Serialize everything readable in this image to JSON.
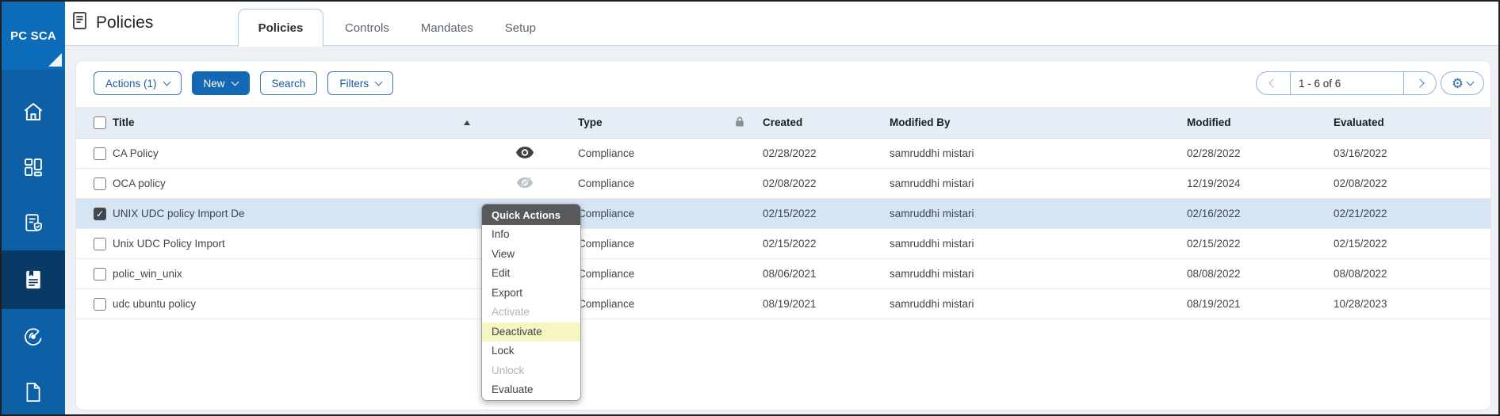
{
  "colors": {
    "accent": "#1468b3",
    "sidebar": "#0d60a6",
    "sidebar-badge": "#0c6cba",
    "sidebar-active": "#093a66",
    "row-highlight": "#d5e5f4",
    "menu-highlight": "#f6f6c3",
    "menu-header-bg": "#58595b",
    "table-header-bg": "#e7edf6"
  },
  "sidebar": {
    "badge": "PC SCA",
    "items": [
      {
        "icon": "home"
      },
      {
        "icon": "dashboard"
      },
      {
        "icon": "reports-shield"
      },
      {
        "icon": "policies-doc",
        "active": true
      },
      {
        "icon": "scans-gauge"
      },
      {
        "icon": "blank-doc"
      }
    ]
  },
  "header": {
    "title": "Policies",
    "tabs": [
      {
        "label": "Policies",
        "active": true
      },
      {
        "label": "Controls",
        "active": false
      },
      {
        "label": "Mandates",
        "active": false
      },
      {
        "label": "Setup",
        "active": false
      }
    ]
  },
  "toolbar": {
    "actions": "Actions (1)",
    "new": "New",
    "search": "Search",
    "filters": "Filters"
  },
  "pagination": {
    "range": "1 - 6 of 6"
  },
  "table": {
    "headers": {
      "title": "Title",
      "type": "Type",
      "created": "Created",
      "modified_by": "Modified By",
      "modified": "Modified",
      "evaluated": "Evaluated"
    },
    "rows": [
      {
        "title": "CA Policy",
        "visibility": "eye",
        "type": "Compliance",
        "created": "02/28/2022",
        "modified_by": "samruddhi mistari",
        "modified": "02/28/2022",
        "evaluated": "03/16/2022",
        "checked": false,
        "highlighted": false
      },
      {
        "title": "OCA policy",
        "visibility": "eye-off",
        "type": "Compliance",
        "created": "02/08/2022",
        "modified_by": "samruddhi mistari",
        "modified": "12/19/2024",
        "evaluated": "02/08/2022",
        "checked": false,
        "highlighted": false
      },
      {
        "title": "UNIX UDC policy Import De",
        "visibility": "eye",
        "type": "Compliance",
        "created": "02/15/2022",
        "modified_by": "samruddhi mistari",
        "modified": "02/16/2022",
        "evaluated": "02/21/2022",
        "checked": true,
        "highlighted": true
      },
      {
        "title": "Unix UDC Policy Import",
        "visibility": "eye",
        "type": "Compliance",
        "created": "02/15/2022",
        "modified_by": "samruddhi mistari",
        "modified": "02/15/2022",
        "evaluated": "02/15/2022",
        "checked": false,
        "highlighted": false
      },
      {
        "title": "polic_win_unix",
        "visibility": "eye",
        "type": "Compliance",
        "created": "08/06/2021",
        "modified_by": "samruddhi mistari",
        "modified": "08/08/2022",
        "evaluated": "08/08/2022",
        "checked": false,
        "highlighted": false
      },
      {
        "title": "udc ubuntu policy",
        "visibility": "eye",
        "type": "Compliance",
        "created": "08/19/2021",
        "modified_by": "samruddhi mistari",
        "modified": "08/19/2021",
        "evaluated": "10/28/2023",
        "checked": false,
        "highlighted": false
      }
    ]
  },
  "quick_actions": {
    "title": "Quick Actions",
    "items": [
      {
        "label": "Info",
        "state": "normal"
      },
      {
        "label": "View",
        "state": "normal"
      },
      {
        "label": "Edit",
        "state": "normal"
      },
      {
        "label": "Export",
        "state": "normal"
      },
      {
        "label": "Activate",
        "state": "disabled"
      },
      {
        "label": "Deactivate",
        "state": "highlighted"
      },
      {
        "label": "Lock",
        "state": "normal"
      },
      {
        "label": "Unlock",
        "state": "disabled"
      },
      {
        "label": "Evaluate",
        "state": "normal"
      }
    ]
  }
}
